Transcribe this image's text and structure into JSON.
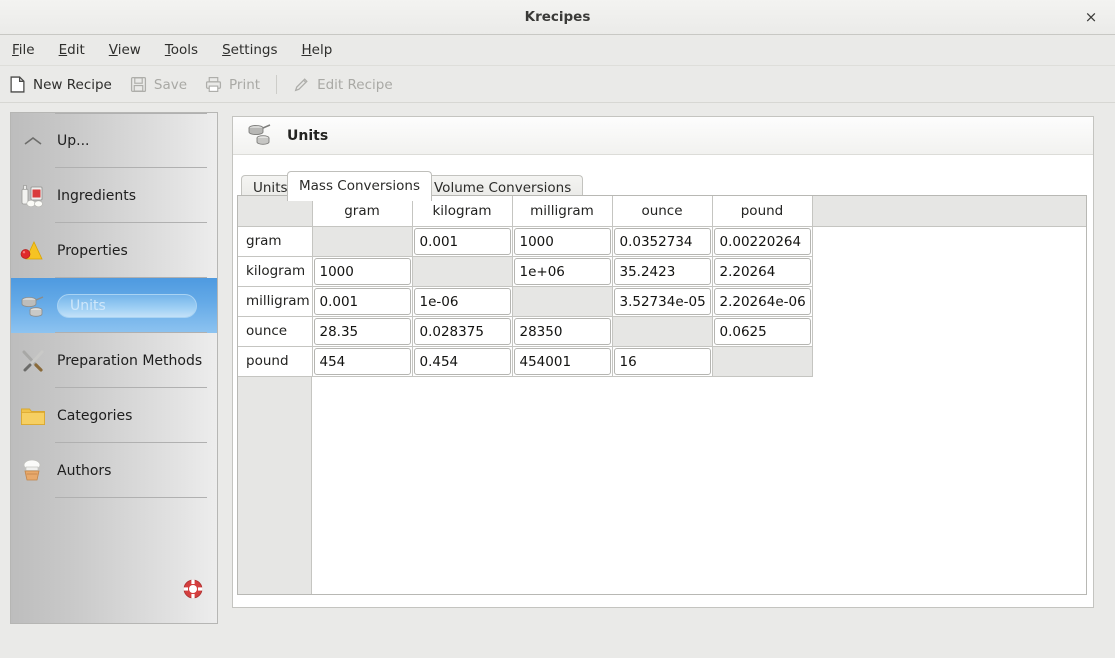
{
  "window": {
    "title": "Krecipes",
    "close_label": "×"
  },
  "menubar": {
    "items": [
      {
        "label": "File",
        "mnemonic": "F"
      },
      {
        "label": "Edit",
        "mnemonic": "E"
      },
      {
        "label": "View",
        "mnemonic": "V"
      },
      {
        "label": "Tools",
        "mnemonic": "T"
      },
      {
        "label": "Settings",
        "mnemonic": "S"
      },
      {
        "label": "Help",
        "mnemonic": "H"
      }
    ]
  },
  "toolbar": {
    "buttons": [
      {
        "label": "New Recipe",
        "icon": "new-document-icon",
        "enabled": true
      },
      {
        "label": "Save",
        "icon": "save-floppy-icon",
        "enabled": false
      },
      {
        "label": "Print",
        "icon": "printer-icon",
        "enabled": false
      },
      {
        "label": "Edit Recipe",
        "icon": "pencil-icon",
        "enabled": false
      }
    ]
  },
  "sidebar": {
    "items": [
      {
        "label": "Up...",
        "icon": "chevron-up-icon",
        "selected": false
      },
      {
        "label": "Ingredients",
        "icon": "ingredients-icon",
        "selected": false
      },
      {
        "label": "Properties",
        "icon": "properties-shapes-icon",
        "selected": false
      },
      {
        "label": "Units",
        "icon": "units-measuring-cups-icon",
        "selected": true
      },
      {
        "label": "Preparation Methods",
        "icon": "utensils-icon",
        "selected": false
      },
      {
        "label": "Categories",
        "icon": "folder-icon",
        "selected": false
      },
      {
        "label": "Authors",
        "icon": "chef-icon",
        "selected": false
      }
    ],
    "bottom_icon": "lifebuoy-icon"
  },
  "panel": {
    "title": "Units",
    "icon": "units-measuring-cups-icon",
    "tabs": [
      {
        "label": "Units",
        "active": false
      },
      {
        "label": "Mass Conversions",
        "active": true
      },
      {
        "label": "Volume Conversions",
        "active": false
      }
    ]
  },
  "chart_data": {
    "type": "table",
    "title": "Mass Conversions",
    "columns": [
      "gram",
      "kilogram",
      "milligram",
      "ounce",
      "pound"
    ],
    "rows": [
      "gram",
      "kilogram",
      "milligram",
      "ounce",
      "pound"
    ],
    "cells": [
      [
        "",
        "0.001",
        "1000",
        "0.0352734",
        "0.00220264"
      ],
      [
        "1000",
        "",
        "1e+06",
        "35.2423",
        "2.20264"
      ],
      [
        "0.001",
        "1e-06",
        "",
        "3.52734e-05",
        "2.20264e-06"
      ],
      [
        "28.35",
        "0.028375",
        "28350",
        "",
        "0.0625"
      ],
      [
        "454",
        "0.454",
        "454001",
        "16",
        ""
      ]
    ],
    "diagonal_empty": true
  },
  "colors": {
    "selection_blue": "#65aae7",
    "window_bg": "#eaeae8",
    "panel_bg": "#ffffff",
    "header_gray": "#e6e6e4",
    "accent_red": "#d43f3f"
  }
}
